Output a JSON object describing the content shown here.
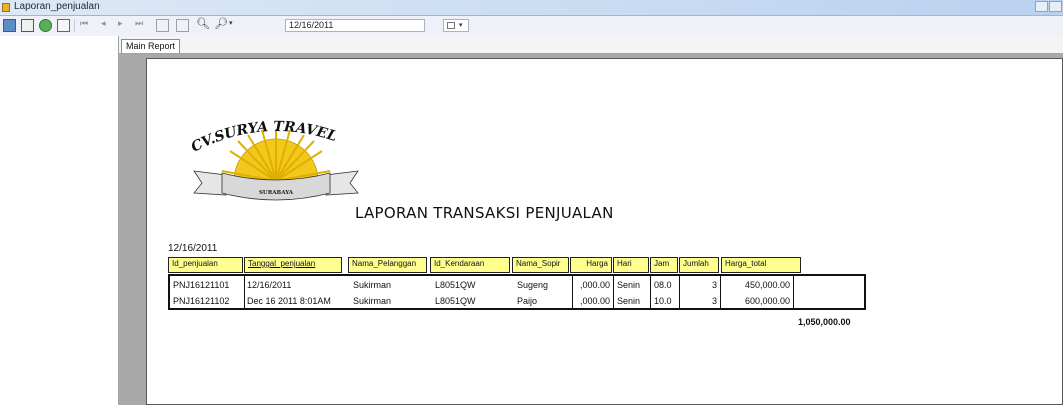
{
  "window": {
    "title": "Laporan_penjualan"
  },
  "toolbar": {
    "date_value": "12/16/2011"
  },
  "tabs": [
    {
      "label": "Main Report"
    }
  ],
  "report": {
    "logo_text": "CV.SURYA TRAVEL",
    "logo_ribbon": "SURABAYA",
    "title": "LAPORAN TRANSAKSI PENJUALAN",
    "print_date": "12/16/2011",
    "columns": [
      "Id_penjualan",
      "Tanggal_penjualan",
      "Nama_Pelanggan",
      "Id_Kendaraan",
      "Nama_Sopir",
      "Harga",
      "Hari",
      "Jam",
      "Jumlah",
      "Harga_total"
    ],
    "rows": [
      [
        "PNJ16121101",
        "12/16/2011",
        "Sukirman",
        "L8051QW",
        "Sugeng",
        ",000.00",
        "Senin",
        "08.0",
        "3",
        "450,000.00"
      ],
      [
        "PNJ16121102",
        "Dec 16 2011  8:01AM",
        "Sukirman",
        "L8051QW",
        "Paijo",
        ",000.00",
        "Senin",
        "10.0",
        "3",
        "600,000.00"
      ]
    ],
    "grand_total": "1,050,000.00"
  },
  "colors": {
    "header_fill": "#ffff90",
    "viewer_bg": "#a9a9a9",
    "sun": "#f2c81e",
    "titlebar": "#cfe0f4"
  }
}
